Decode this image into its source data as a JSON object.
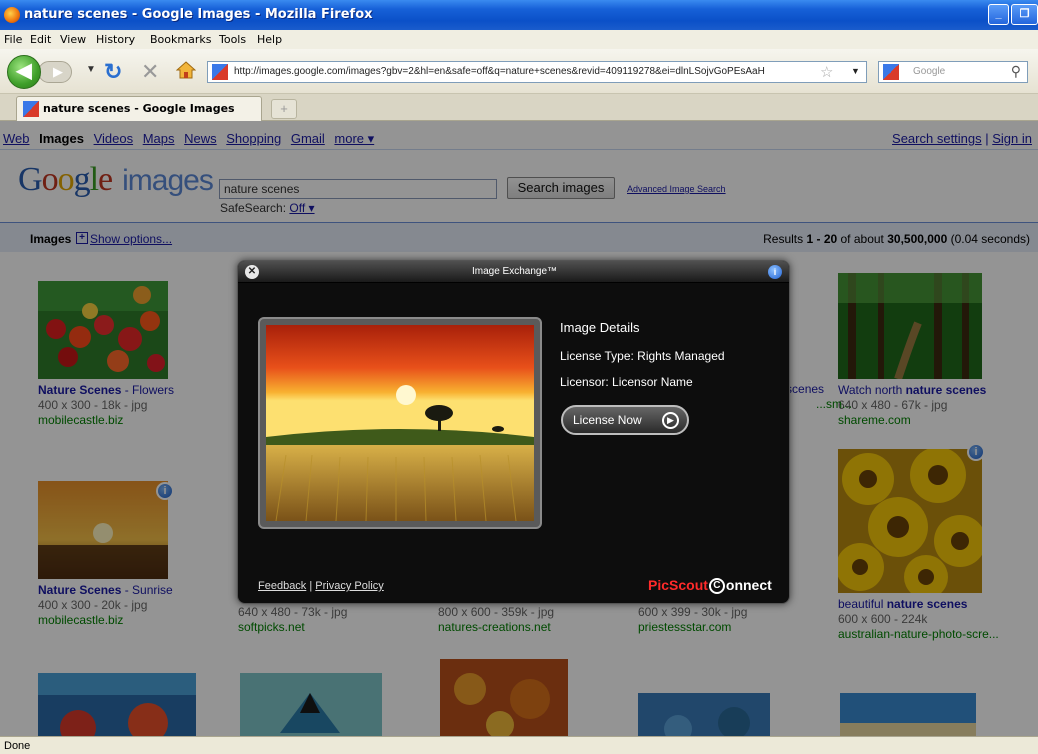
{
  "window": {
    "title": "nature scenes - Google Images - Mozilla Firefox"
  },
  "menu": [
    "File",
    "Edit",
    "View",
    "History",
    "Bookmarks",
    "Tools",
    "Help"
  ],
  "nav": {
    "url": "http://images.google.com/images?gbv=2&hl=en&safe=off&q=nature+scenes&revid=409119278&ei=dlnLSojvGoPEsAaH",
    "search_placeholder": "Google"
  },
  "tabs": [
    {
      "label": "nature scenes - Google Images"
    }
  ],
  "google": {
    "topnav": [
      "Web",
      "Images",
      "Videos",
      "Maps",
      "News",
      "Shopping",
      "Gmail",
      "more ▾"
    ],
    "search_settings": "Search settings",
    "sign_in": "Sign in",
    "logo": [
      "G",
      "o",
      "o",
      "g",
      "l",
      "e"
    ],
    "logo_suffix": "images",
    "query": "nature scenes",
    "search_button": "Search images",
    "advanced": "Advanced Image Search",
    "safesearch_label": "SafeSearch:",
    "safesearch_value": "Off ▾",
    "images_label": "Images",
    "show_options": "Show options...",
    "results_prefix": "Results ",
    "results_range": "1 - 20",
    "results_of": " of about ",
    "results_total": "30,500,000",
    "results_time": " (0.04 seconds)"
  },
  "results": [
    {
      "title_bold": "Nature Scenes",
      "title_rest": " - Flowers",
      "meta": "400 x 300 - 18k - jpg",
      "site": "mobilecastle.biz"
    },
    {
      "title_bold": "",
      "title_rest": "...cal nature scenes",
      "meta": "",
      "site": "...sm..."
    },
    {
      "title_pre": "Watch north ",
      "title_bold": "nature scenes",
      "meta": "640 x 480 - 67k - jpg",
      "site": "shareme.com"
    },
    {
      "title_bold": "Nature Scenes",
      "title_rest": " - Sunrise",
      "meta": "400 x 300 - 20k - jpg",
      "site": "mobilecastle.biz"
    },
    {
      "meta": "640 x 480 - 73k - jpg",
      "site": "softpicks.net"
    },
    {
      "meta": "800 x 600 - 359k - jpg",
      "site": "natures-creations.net"
    },
    {
      "meta": "600 x 399 - 30k - jpg",
      "site": "priestessstar.com"
    },
    {
      "title_pre": "beautiful ",
      "title_bold": "nature scenes",
      "meta": "600 x 600 - 224k",
      "site": "australian-nature-photo-scre..."
    }
  ],
  "modal": {
    "title": "Image Exchange™",
    "details_heading": "Image Details",
    "license_type": "License Type: Rights Managed",
    "licensor": "Licensor: Licensor Name",
    "license_button": "License Now",
    "feedback": "Feedback",
    "separator": "|",
    "privacy": "Privacy Policy",
    "brand_a": "PicScout",
    "brand_b": "onnect"
  },
  "status": "Done"
}
